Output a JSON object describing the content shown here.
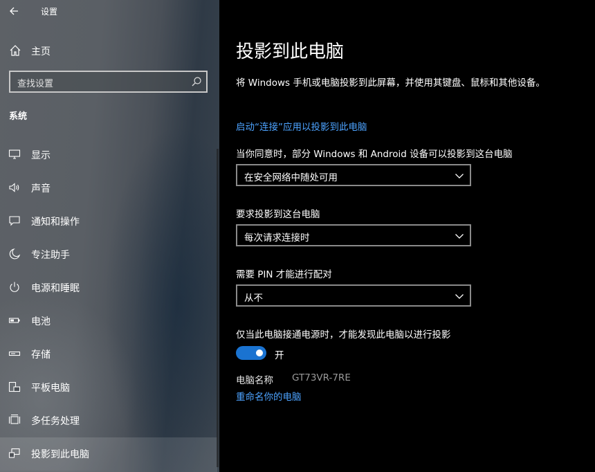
{
  "window": {
    "title": "设置"
  },
  "sidebar": {
    "home_label": "主页",
    "search_placeholder": "查找设置",
    "section_title": "系统",
    "items": [
      {
        "label": "显示",
        "icon": "monitor-icon"
      },
      {
        "label": "声音",
        "icon": "speaker-icon"
      },
      {
        "label": "通知和操作",
        "icon": "notification-icon"
      },
      {
        "label": "专注助手",
        "icon": "moon-icon"
      },
      {
        "label": "电源和睡眠",
        "icon": "power-icon"
      },
      {
        "label": "电池",
        "icon": "battery-icon"
      },
      {
        "label": "存储",
        "icon": "storage-icon"
      },
      {
        "label": "平板电脑",
        "icon": "tablet-icon"
      },
      {
        "label": "多任务处理",
        "icon": "multitask-icon"
      },
      {
        "label": "投影到此电脑",
        "icon": "project-icon",
        "active": true
      }
    ]
  },
  "main": {
    "title": "投影到此电脑",
    "description": "将 Windows 手机或电脑投影到此屏幕，并使用其键盘、鼠标和其他设备。",
    "connect_link": "启动“连接”应用以投影到此电脑",
    "availability": {
      "label": "当你同意时，部分 Windows 和 Android 设备可以投影到这台电脑",
      "value": "在安全网络中随处可用"
    },
    "ask_to_project": {
      "label": "要求投影到这台电脑",
      "value": "每次请求连接时"
    },
    "require_pin": {
      "label": "需要 PIN 才能进行配对",
      "value": "从不"
    },
    "power_only": {
      "label": "仅当此电脑接通电源时，才能发现此电脑以进行投影",
      "toggle_state": "开",
      "on": true
    },
    "pc_name_label": "电脑名称",
    "pc_name_value": "GT73VR-7RE",
    "rename_link": "重命名你的电脑"
  },
  "colors": {
    "accent": "#1a73d1",
    "link": "#4da3ff"
  }
}
